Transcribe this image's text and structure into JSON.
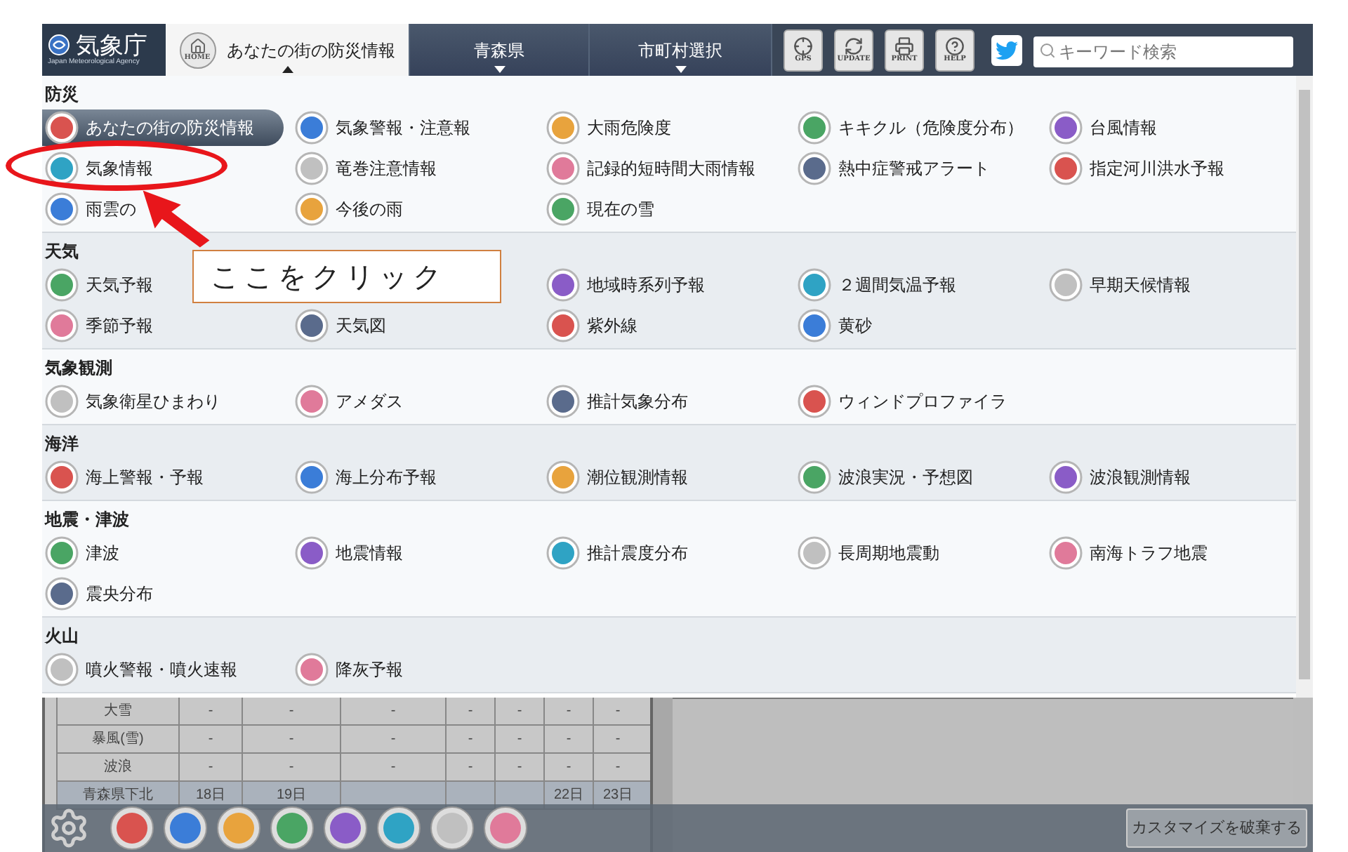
{
  "header": {
    "logo": {
      "name": "気象庁",
      "subtitle": "Japan Meteorological Agency"
    },
    "tabs": [
      {
        "label": "あなたの街の防災情報",
        "icon_label": "HOME",
        "selected": true
      },
      {
        "label": "青森県",
        "selected": false
      },
      {
        "label": "市町村選択",
        "selected": false
      }
    ],
    "tool_buttons": [
      {
        "kind": "gps",
        "label": "GPS"
      },
      {
        "kind": "update",
        "label": "UPDATE"
      },
      {
        "kind": "print",
        "label": "PRINT"
      },
      {
        "kind": "help",
        "label": "HELP"
      }
    ],
    "search": {
      "placeholder": "キーワード検索"
    }
  },
  "menu": {
    "sections": [
      {
        "title": "防災",
        "items": [
          {
            "label": "あなたの街の防災情報",
            "selected": true
          },
          {
            "label": "気象警報・注意報",
            "selected": false
          },
          {
            "label": "大雨危険度",
            "selected": false
          },
          {
            "label": "キキクル（危険度分布）",
            "selected": false
          },
          {
            "label": "台風情報",
            "selected": false
          },
          {
            "label": "気象情報",
            "selected": false
          },
          {
            "label": "竜巻注意情報",
            "selected": false
          },
          {
            "label": "記録的短時間大雨情報",
            "selected": false
          },
          {
            "label": "熱中症警戒アラート",
            "selected": false
          },
          {
            "label": "指定河川洪水予報",
            "selected": false
          },
          {
            "label": "雨雲の",
            "selected": false
          },
          {
            "label": "今後の雨",
            "selected": false
          },
          {
            "label": "現在の雪",
            "selected": false
          }
        ]
      },
      {
        "title": "天気",
        "items": [
          {
            "label": "天気予報",
            "selected": false
          },
          {
            "label": "地域時系列予報",
            "selected": false
          },
          {
            "label": "２週間気温予報",
            "selected": false
          },
          {
            "label": "早期天候情報",
            "selected": false
          },
          {
            "label": "季節予報",
            "selected": false
          },
          {
            "label": "天気図",
            "selected": false
          },
          {
            "label": "紫外線",
            "selected": false
          },
          {
            "label": "黄砂",
            "selected": false
          }
        ]
      },
      {
        "title": "気象観測",
        "items": [
          {
            "label": "気象衛星ひまわり",
            "selected": false
          },
          {
            "label": "アメダス",
            "selected": false
          },
          {
            "label": "推計気象分布",
            "selected": false
          },
          {
            "label": "ウィンドプロファイラ",
            "selected": false
          }
        ]
      },
      {
        "title": "海洋",
        "items": [
          {
            "label": "海上警報・予報",
            "selected": false
          },
          {
            "label": "海上分布予報",
            "selected": false
          },
          {
            "label": "潮位観測情報",
            "selected": false
          },
          {
            "label": "波浪実況・予想図",
            "selected": false
          },
          {
            "label": "波浪観測情報",
            "selected": false
          }
        ]
      },
      {
        "title": "地震・津波",
        "items": [
          {
            "label": "津波",
            "selected": false
          },
          {
            "label": "地震情報",
            "selected": false
          },
          {
            "label": "推計震度分布",
            "selected": false
          },
          {
            "label": "長周期地震動",
            "selected": false
          },
          {
            "label": "南海トラフ地震",
            "selected": false
          },
          {
            "label": "震央分布",
            "selected": false
          }
        ]
      },
      {
        "title": "火山",
        "items": [
          {
            "label": "噴火警報・噴火速報",
            "selected": false
          },
          {
            "label": "降灰予報",
            "selected": false
          }
        ]
      }
    ]
  },
  "annotation": {
    "callout": "ここをクリック"
  },
  "background_table": {
    "rows": [
      {
        "cells": [
          "大雪",
          "-",
          "-",
          "-",
          "-",
          "-",
          "-",
          "-"
        ]
      },
      {
        "cells": [
          "暴風(雪)",
          "-",
          "-",
          "-",
          "-",
          "-",
          "-",
          "-"
        ]
      },
      {
        "cells": [
          "波浪",
          "-",
          "-",
          "-",
          "-",
          "-",
          "-",
          "-"
        ]
      },
      {
        "kind": "header",
        "cells": [
          "青森県下北",
          "18日",
          "19日",
          "",
          "",
          "",
          "22日",
          "23日"
        ]
      }
    ]
  },
  "dock": {
    "button": "カスタマイズを破棄する"
  }
}
